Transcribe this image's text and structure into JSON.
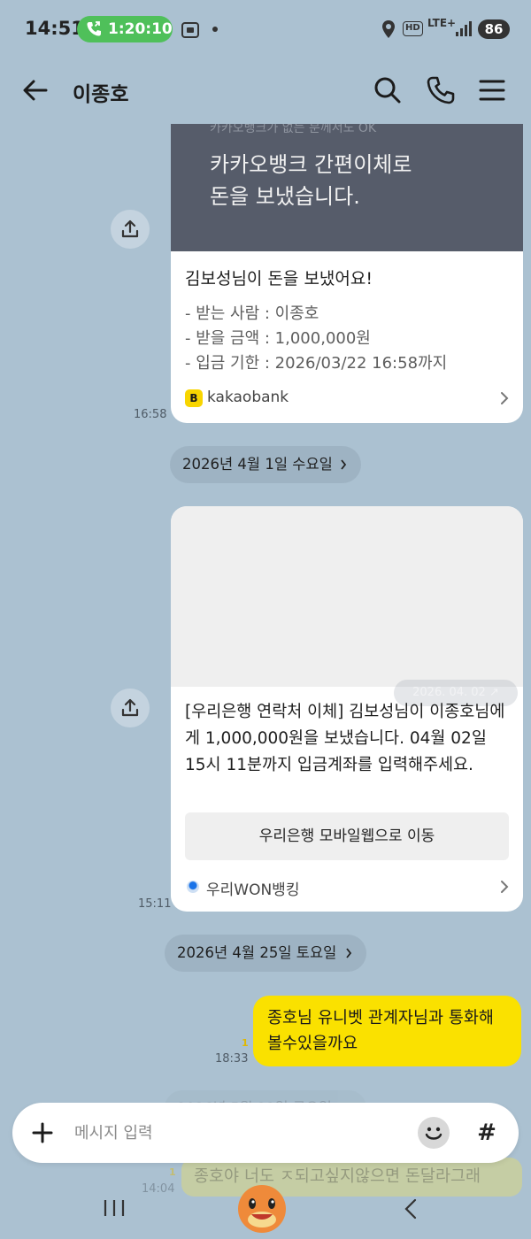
{
  "status_bar": {
    "time": "14:51",
    "call_timer": "1:20:10",
    "network": "LTE+",
    "hd": "HD",
    "battery": "86",
    "call_pill_color": "#4fc05a"
  },
  "header": {
    "title": "이종호",
    "icons": [
      "back-arrow-icon",
      "search-icon",
      "phone-icon",
      "menu-icon"
    ]
  },
  "messages": {
    "kakao_card": {
      "faded_top": "카카오뱅크가 없는 분께서도 OK",
      "headline_line1": "카카오뱅크 간편이체로",
      "headline_line2": "돈을 보냈습니다.",
      "title": "김보성님이 돈을 보냈어요!",
      "receiver": "- 받는 사람 : 이종호",
      "amount": "- 받을 금액 : 1,000,000원",
      "deadline": "- 입금 기한 : 2026/03/22 16:58까지",
      "footer": "kakaobank",
      "footer_logo": "B",
      "time": "16:58"
    },
    "date_1": "2026년 4월 1일 수요일",
    "woori_card": {
      "ghost_label": "2026. 04. 02 ↗",
      "text": "[우리은행 연락처 이체] 김보성님이 이종호님에게 1,000,000원을 보냈습니다. 04월 02일 15시 11분까지 입금계좌를 입력해주세요.",
      "button": "우리은행 모바일웹으로 이동",
      "footer": "우리WON뱅킹",
      "time": "15:11"
    },
    "date_2": "2026년 4월 25일 토요일",
    "my_message": {
      "text": "종호님 유니벳 관계자님과  통화해볼수있을까요",
      "time": "18:33",
      "unread": "1"
    },
    "date_3": "2026년 5월 22일 금요일",
    "faded_message": {
      "text": "종호야 너도 ㅈ되고싶지않으면 돈달라그래",
      "time": "14:04",
      "unread": "1"
    }
  },
  "input_bar": {
    "placeholder": "메시지 입력",
    "hash": "#"
  },
  "colors": {
    "background": "#abc1d1",
    "my_bubble": "#fae100",
    "kakao_yellow": "#f8d500"
  }
}
